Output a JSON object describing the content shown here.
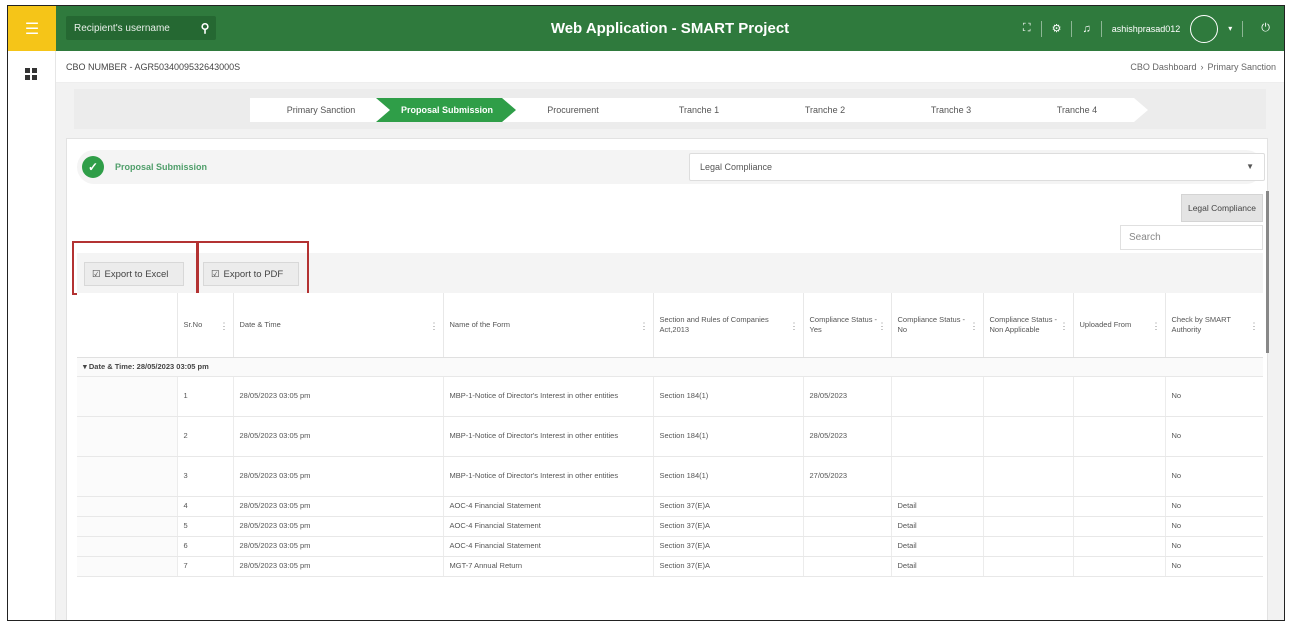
{
  "topbar": {
    "search_placeholder": "Recipient's username",
    "search_icon": "search-icon",
    "title": "Web Application - SMART Project",
    "username": "ashishprasad012",
    "icons": [
      "fullscreen-icon",
      "settings-icon",
      "bell-icon",
      "chevron-down-icon",
      "power-icon"
    ]
  },
  "subheader": {
    "cbo_number": "CBO NUMBER - AGR5034009532643000S",
    "breadcrumb": [
      "CBO Dashboard",
      "Primary Sanction"
    ]
  },
  "stepper": [
    {
      "label": "Primary Sanction",
      "active": false
    },
    {
      "label": "Proposal Submission",
      "active": true
    },
    {
      "label": "Procurement",
      "active": false
    },
    {
      "label": "Tranche 1",
      "active": false
    },
    {
      "label": "Tranche 2",
      "active": false
    },
    {
      "label": "Tranche 3",
      "active": false
    },
    {
      "label": "Tranche 4",
      "active": false
    }
  ],
  "panel": {
    "status_label": "Proposal Submission",
    "select_value": "Legal Compliance",
    "legal_button": "Legal Compliance",
    "search_placeholder": "Search",
    "export_excel": "Export to Excel",
    "export_pdf": "Export to PDF"
  },
  "table": {
    "columns": [
      "",
      "Sr.No",
      "Date & Time",
      "Name of the Form",
      "Section and Rules of Companies Act,2013",
      "Compliance Status - Yes",
      "Compliance Status - No",
      "Compliance Status - Non Applicable",
      "Uploaded From",
      "Check by SMART Authority"
    ],
    "group_label": "Date & Time: 28/05/2023 03:05 pm",
    "rows": [
      {
        "sr": "1",
        "date": "28/05/2023 03:05 pm",
        "form": "MBP-1-Notice of Director's Interest in other entities",
        "section": "Section 184(1)",
        "yes": "28/05/2023",
        "no": "",
        "na": "",
        "uploaded": "",
        "check": "No"
      },
      {
        "sr": "2",
        "date": "28/05/2023 03:05 pm",
        "form": "MBP-1-Notice of Director's Interest in other entities",
        "section": "Section 184(1)",
        "yes": "28/05/2023",
        "no": "",
        "na": "",
        "uploaded": "",
        "check": "No"
      },
      {
        "sr": "3",
        "date": "28/05/2023 03:05 pm",
        "form": "MBP-1-Notice of Director's Interest in other entities",
        "section": "Section 184(1)",
        "yes": "27/05/2023",
        "no": "",
        "na": "",
        "uploaded": "",
        "check": "No"
      },
      {
        "sr": "4",
        "date": "28/05/2023 03:05 pm",
        "form": "AOC-4 Financial Statement",
        "section": "Section 37(E)A",
        "yes": "",
        "no": "Detail",
        "na": "",
        "uploaded": "",
        "check": "No"
      },
      {
        "sr": "5",
        "date": "28/05/2023 03:05 pm",
        "form": "AOC-4 Financial Statement",
        "section": "Section 37(E)A",
        "yes": "",
        "no": "Detail",
        "na": "",
        "uploaded": "",
        "check": "No"
      },
      {
        "sr": "6",
        "date": "28/05/2023 03:05 pm",
        "form": "AOC-4 Financial Statement",
        "section": "Section 37(E)A",
        "yes": "",
        "no": "Detail",
        "na": "",
        "uploaded": "",
        "check": "No"
      },
      {
        "sr": "7",
        "date": "28/05/2023 03:05 pm",
        "form": "MGT-7 Annual Return",
        "section": "Section 37(E)A",
        "yes": "",
        "no": "Detail",
        "na": "",
        "uploaded": "",
        "check": "No"
      }
    ]
  }
}
